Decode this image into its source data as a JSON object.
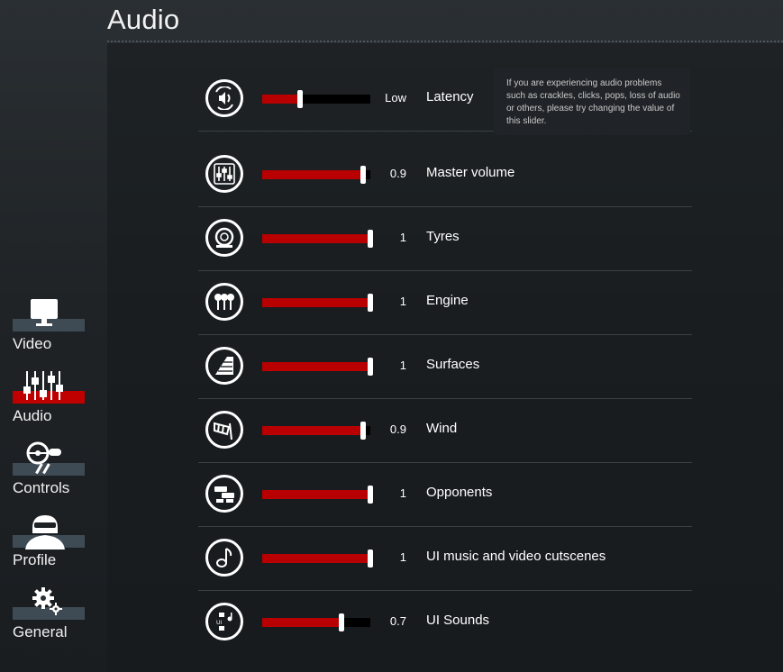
{
  "page": {
    "title": "Audio"
  },
  "sidebar": {
    "items": [
      {
        "label": "Video",
        "icon": "monitor-icon",
        "active": false
      },
      {
        "label": "Audio",
        "icon": "mixer-icon",
        "active": true
      },
      {
        "label": "Controls",
        "icon": "steering-wheel-icon",
        "active": false
      },
      {
        "label": "Profile",
        "icon": "driver-helmet-icon",
        "active": false
      },
      {
        "label": "General",
        "icon": "gears-icon",
        "active": false
      }
    ]
  },
  "settings": [
    {
      "label": "Latency",
      "value": "Low",
      "level": 0.35,
      "icon": "speaker-sync-icon"
    },
    {
      "label": "Master volume",
      "value": "0.9",
      "level": 0.93,
      "icon": "mixer-icon"
    },
    {
      "label": "Tyres",
      "value": "1",
      "level": 1.0,
      "icon": "tyre-icon"
    },
    {
      "label": "Engine",
      "value": "1",
      "level": 1.0,
      "icon": "pistons-icon"
    },
    {
      "label": "Surfaces",
      "value": "1",
      "level": 1.0,
      "icon": "road-surface-icon"
    },
    {
      "label": "Wind",
      "value": "0.9",
      "level": 0.93,
      "icon": "windsock-icon"
    },
    {
      "label": "Opponents",
      "value": "1",
      "level": 1.0,
      "icon": "opponent-cars-icon"
    },
    {
      "label": "UI music and video cutscenes",
      "value": "1",
      "level": 1.0,
      "icon": "music-note-icon"
    },
    {
      "label": "UI Sounds",
      "value": "0.7",
      "level": 0.73,
      "icon": "ui-sounds-icon"
    }
  ],
  "tooltip": {
    "text": "If you are experiencing audio problems such as crackles, clicks, pops, loss of audio or others, please try changing the value of this slider."
  },
  "colors": {
    "accent": "#b80000",
    "active_nav": "#c00000",
    "inactive_nav": "#3f4b54",
    "track": "#000000"
  }
}
